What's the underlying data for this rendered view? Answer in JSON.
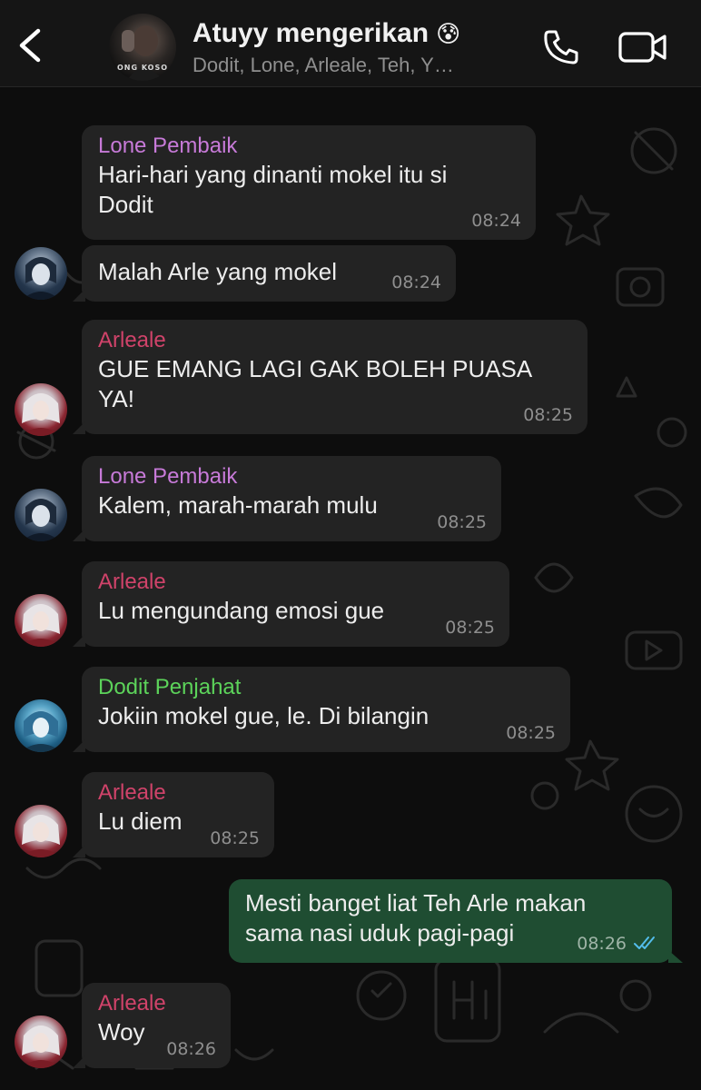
{
  "header": {
    "title": "Atuyy mengerikan",
    "title_emoji": "😰",
    "subtitle": "Dodit, Lone, Arleale, Teh, Y…",
    "avatar_caption": "ONG KOSO"
  },
  "colors": {
    "background": "#0d0d0d",
    "header": "#151515",
    "bubble_in": "#232323",
    "bubble_out": "#1f4d32",
    "sender_lone": "#c77ad8",
    "sender_arleale": "#d0436a",
    "sender_dodit": "#5cd35a",
    "read_ticks": "#53bdeb"
  },
  "messages": [
    {
      "sender": "Lone Pembaik",
      "line1": "Hari-hari yang dinanti mokel itu si",
      "line2": "Dodit",
      "time": "08:24"
    },
    {
      "sender": "",
      "line1": "Malah Arle yang mokel",
      "time": "08:24"
    },
    {
      "sender": "Arleale",
      "line1": "GUE EMANG LAGI GAK BOLEH PUASA",
      "line2": "YA!",
      "time": "08:25"
    },
    {
      "sender": "Lone Pembaik",
      "line1": "Kalem, marah-marah mulu",
      "time": "08:25"
    },
    {
      "sender": "Arleale",
      "line1": "Lu mengundang emosi gue",
      "time": "08:25"
    },
    {
      "sender": "Dodit Penjahat",
      "line1": "Jokiin mokel gue, le. Di bilangin",
      "time": "08:25"
    },
    {
      "sender": "Arleale",
      "line1": "Lu diem",
      "time": "08:25"
    },
    {
      "sender": "",
      "line1": "Mesti banget liat Teh Arle makan",
      "line2": "sama nasi uduk pagi-pagi",
      "time": "08:26",
      "outgoing": true
    },
    {
      "sender": "Arleale",
      "line1": "Woy",
      "time": "08:26"
    }
  ]
}
